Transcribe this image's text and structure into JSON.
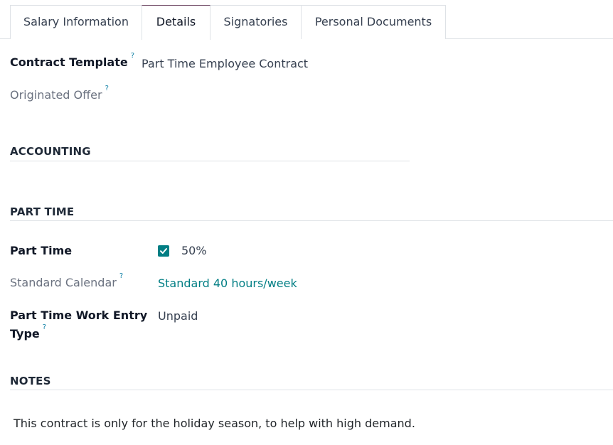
{
  "tabs": [
    {
      "label": "Salary Information"
    },
    {
      "label": "Details"
    },
    {
      "label": "Signatories"
    },
    {
      "label": "Personal Documents"
    }
  ],
  "fields": {
    "contract_template": {
      "label": "Contract Template",
      "help": "?",
      "value": "Part Time Employee Contract"
    },
    "originated_offer": {
      "label": "Originated Offer",
      "help": "?",
      "value": ""
    }
  },
  "sections": {
    "accounting": {
      "title": "ACCOUNTING"
    },
    "part_time": {
      "title": "PART TIME",
      "part_time": {
        "label": "Part Time",
        "checked": true,
        "value": "50%"
      },
      "standard_calendar": {
        "label": "Standard Calendar",
        "help": "?",
        "value": "Standard 40 hours/week"
      },
      "work_entry_type": {
        "label_line1": "Part Time Work Entry",
        "label_line2": "Type",
        "help": "?",
        "value": "Unpaid"
      }
    },
    "notes": {
      "title": "NOTES",
      "text": "This contract is only for the holiday season, to help with high demand."
    }
  },
  "colors": {
    "accent_teal": "#017e84",
    "active_tab_top": "#714B67",
    "help_icon": "#0a7ea4"
  }
}
